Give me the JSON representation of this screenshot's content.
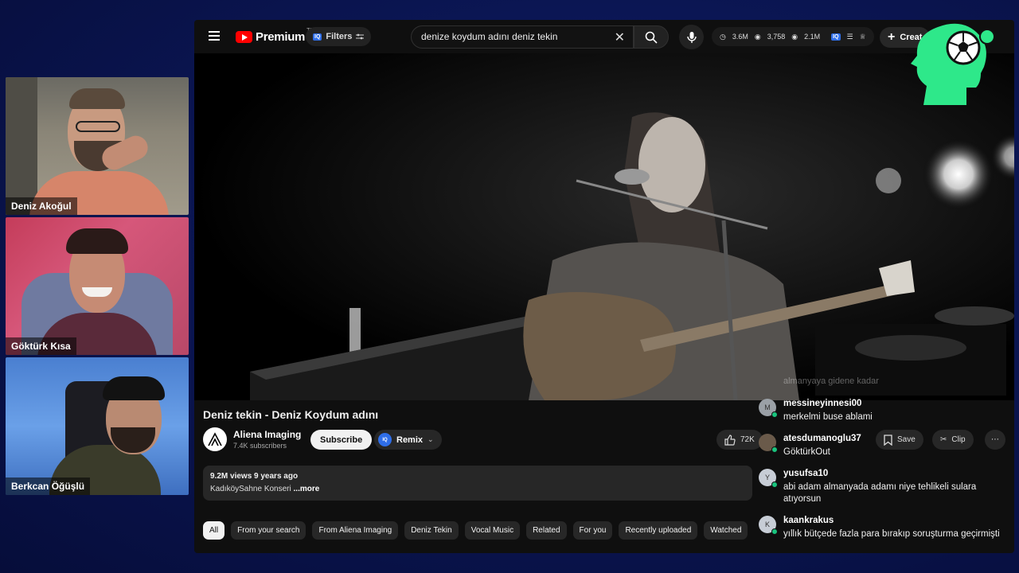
{
  "participants": [
    {
      "name": "Deniz Akoğul"
    },
    {
      "name": "Göktürk Kısa"
    },
    {
      "name": "Berkcan Öğüşlü"
    }
  ],
  "youtube": {
    "logo_text": "Premium",
    "region": "TR",
    "filters_label": "Filters",
    "search_query": "denize koydum adını deniz tekin",
    "stats": {
      "views": "3.6M",
      "watching": "3,758",
      "subs": "2.1M"
    },
    "create_label": "Creat",
    "video": {
      "title": "Deniz tekin - Deniz Koydum adını",
      "channel_name": "Aliena Imaging",
      "channel_subs": "7.4K subscribers",
      "subscribe_label": "Subscribe",
      "remix_label": "Remix",
      "likes": "72K",
      "save_label": "Save",
      "clip_label": "Clip",
      "views_line": "9.2M views  9 years ago",
      "description": "KadıköySahne Konseri",
      "more_label": "...more"
    },
    "chips": [
      "All",
      "From your search",
      "From Aliena Imaging",
      "Deniz Tekin",
      "Vocal Music",
      "Related",
      "For you",
      "Recently uploaded",
      "Watched"
    ]
  },
  "chat": {
    "faded_message": "almanyaya gidene kadar",
    "messages": [
      {
        "initial": "M",
        "user": "messineyinnesi00",
        "text": "merkelmi buse ablami"
      },
      {
        "initial": "",
        "user": "atesdumanoglu37",
        "text": "GöktürkOut"
      },
      {
        "initial": "Y",
        "user": "yusufsa10",
        "text": "abi adam almanyada adamı niye tehlikeli sulara atıyorsun"
      },
      {
        "initial": "K",
        "user": "kaankrakus",
        "text": "yıllık bütçede fazla para bırakıp soruşturma geçirmişti"
      }
    ]
  }
}
